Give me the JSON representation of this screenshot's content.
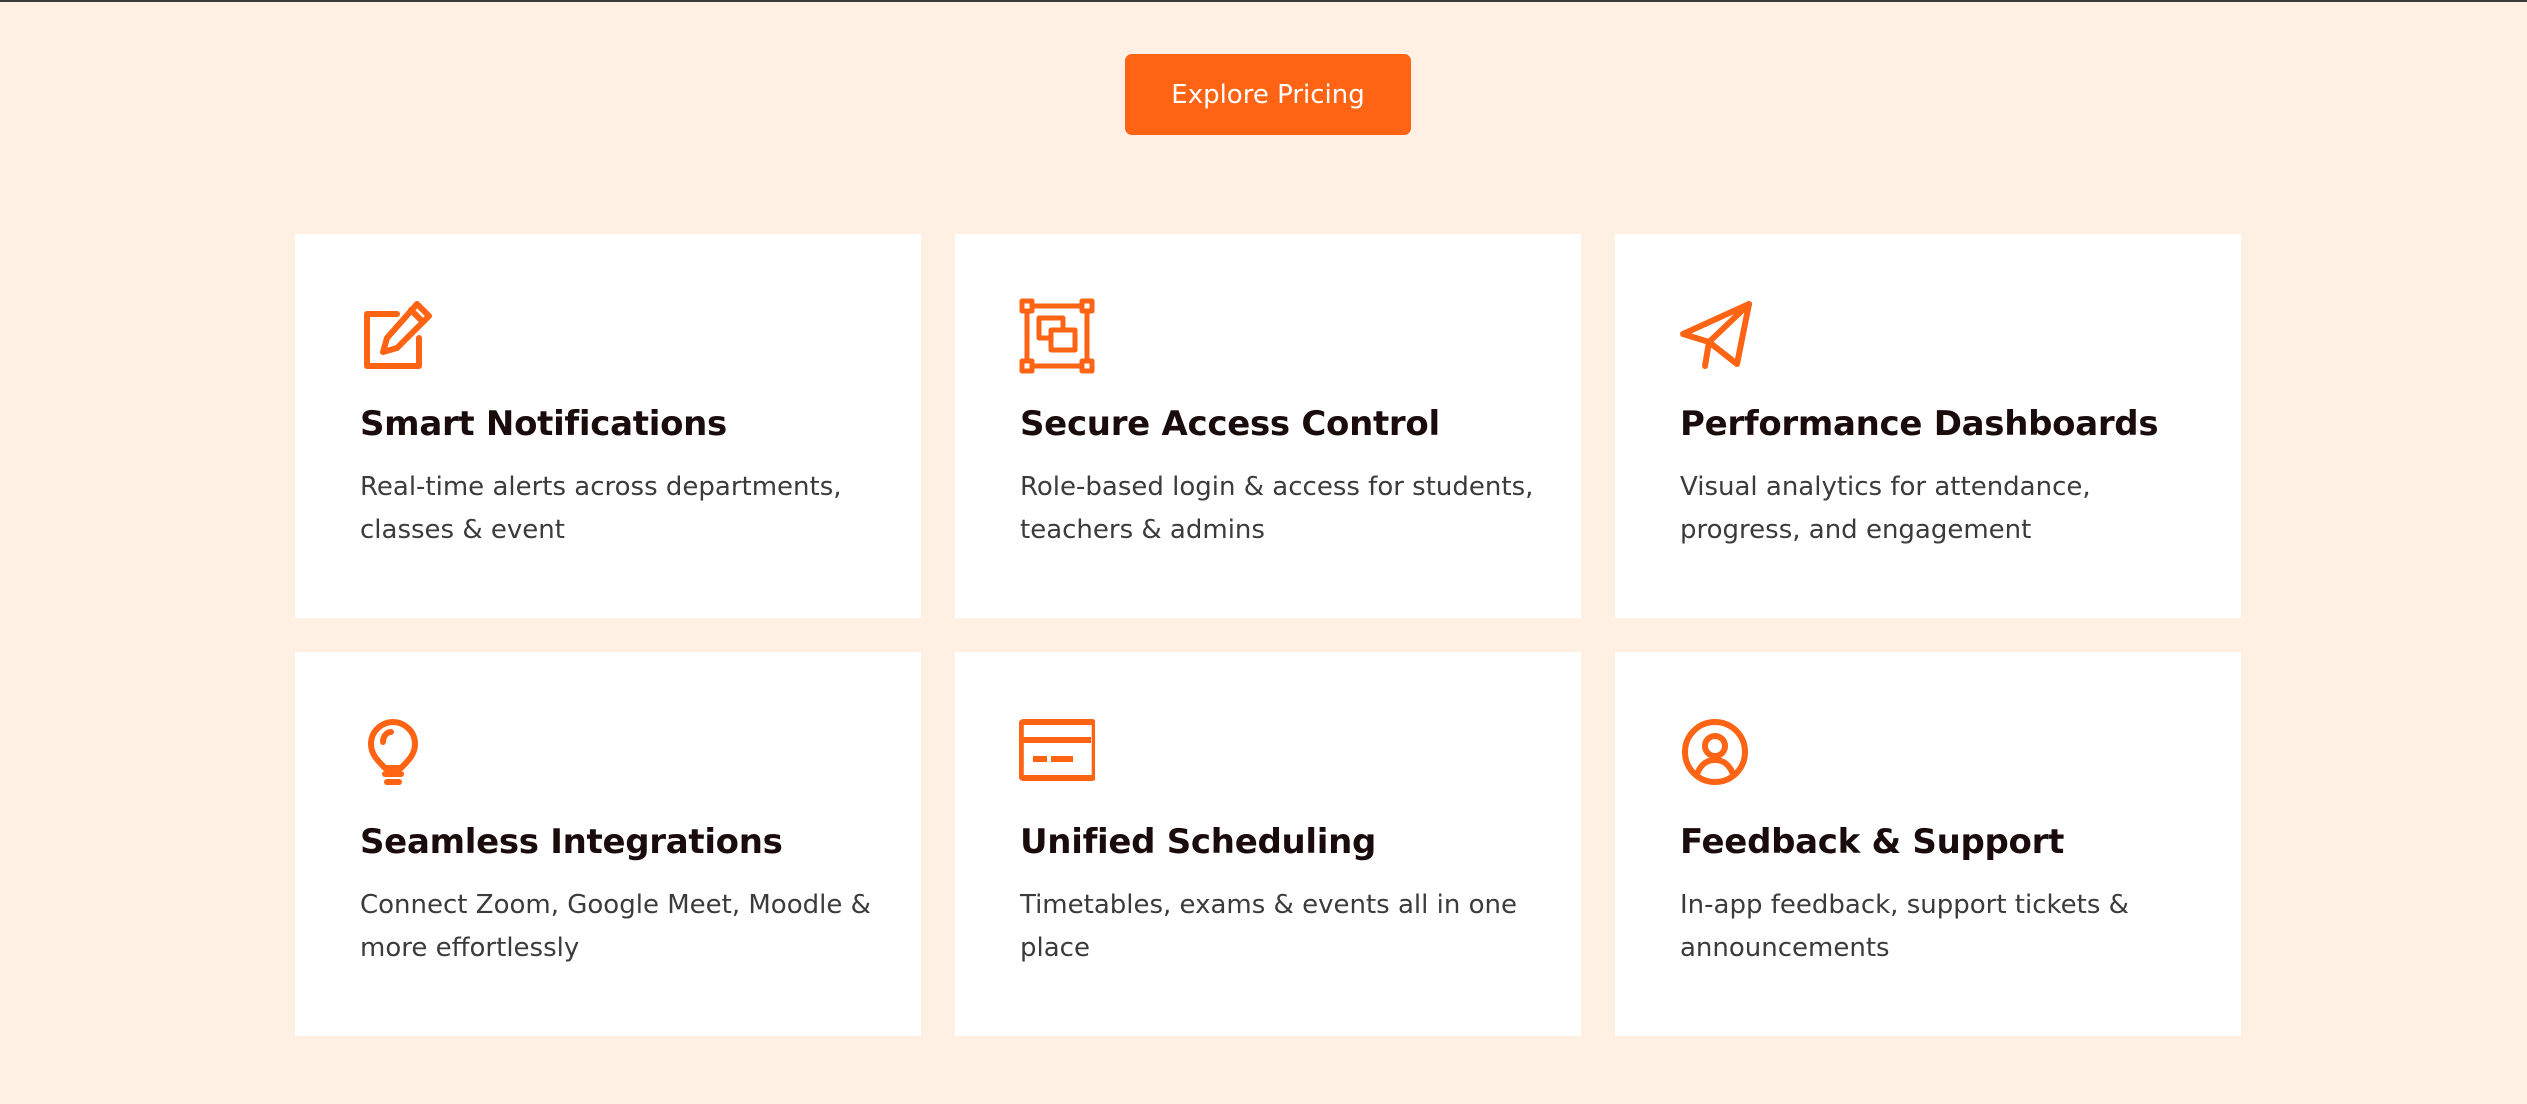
{
  "cta": {
    "label": "Explore Pricing"
  },
  "colors": {
    "accent": "#ff6314",
    "background": "#fff0e3",
    "card": "#ffffff",
    "title": "#1a0c0c",
    "text": "#3b3b3b"
  },
  "features": [
    {
      "icon": "edit-icon",
      "title": "Smart Notifications",
      "description": "Real-time alerts across departments, classes & event"
    },
    {
      "icon": "layers-frame-icon",
      "title": "Secure Access Control",
      "description": "Role-based login & access for students, teachers & admins"
    },
    {
      "icon": "paper-plane-icon",
      "title": "Performance Dashboards",
      "description": "Visual analytics for attendance, progress, and engagement"
    },
    {
      "icon": "lightbulb-icon",
      "title": "Seamless Integrations",
      "description": "Connect Zoom, Google Meet, Moodle & more effortlessly"
    },
    {
      "icon": "credit-card-icon",
      "title": "Unified Scheduling",
      "description": "Timetables, exams & events all in one place"
    },
    {
      "icon": "user-circle-icon",
      "title": "Feedback & Support",
      "description": "In-app feedback, support tickets & announcements"
    }
  ]
}
